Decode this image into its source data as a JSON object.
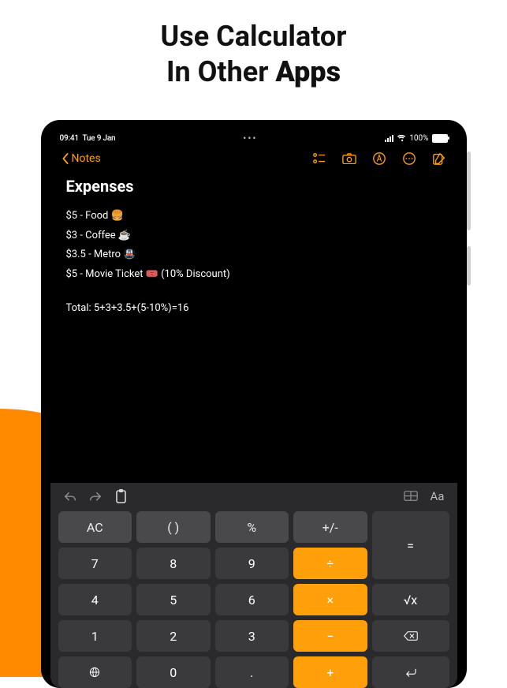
{
  "promo": {
    "line1": "Use Calculator",
    "line2_a": "In Other ",
    "line2_b": "Apps"
  },
  "status": {
    "time": "09:41",
    "date": "Tue 9 Jan",
    "battery": "100%"
  },
  "header": {
    "back": "Notes"
  },
  "note": {
    "title": "Expenses",
    "lines": [
      "$5 - Food 🍔",
      "$3 - Coffee ☕",
      "$3.5 - Metro 🚇",
      "$5 - Movie Ticket 🎟️ (10% Discount)"
    ],
    "total": "Total: 5+3+3.5+(5-10%)=16"
  },
  "toolbar": {
    "aa": "Aa"
  },
  "keys": {
    "ac": "AC",
    "paren": "( )",
    "pct": "%",
    "pm": "+/-",
    "k7": "7",
    "k8": "8",
    "k9": "9",
    "div": "÷",
    "k4": "4",
    "k5": "5",
    "k6": "6",
    "mul": "×",
    "k1": "1",
    "k2": "2",
    "k3": "3",
    "sub": "−",
    "k0": "0",
    "dot": ".",
    "add": "+",
    "eq": "=",
    "sqrt": "√x"
  }
}
